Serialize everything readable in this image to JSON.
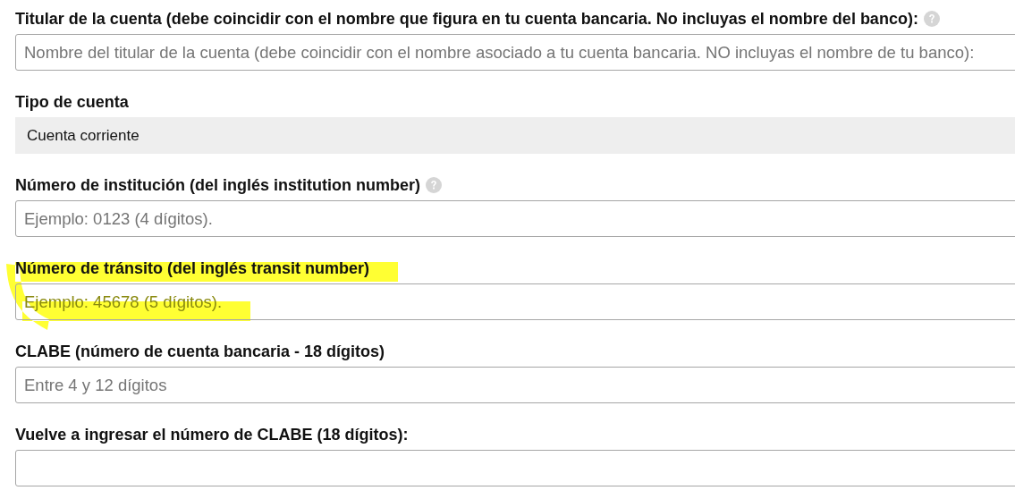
{
  "fields": [
    {
      "kind": "input",
      "label": "Titular de la cuenta (debe coincidir con el nombre que figura en tu cuenta bancaria. No incluyas el nombre del banco):",
      "help": true,
      "placeholder": "Nombre del titular de la cuenta (debe coincidir con el nombre asociado a tu cuenta bancaria. NO incluyas el nombre de tu banco):",
      "highlighted": false
    },
    {
      "kind": "static",
      "label": "Tipo de cuenta",
      "help": false,
      "value": "Cuenta corriente",
      "highlighted": false
    },
    {
      "kind": "input",
      "label": "Número de institución (del inglés institution number)",
      "help": true,
      "placeholder": "Ejemplo: 0123 (4 dígitos).",
      "highlighted": false
    },
    {
      "kind": "input",
      "label": "Número de tránsito (del inglés transit number)",
      "help": false,
      "placeholder": "Ejemplo: 45678 (5 dígitos).",
      "highlighted": true
    },
    {
      "kind": "input",
      "label": "CLABE (número de cuenta bancaria - 18 dígitos)",
      "help": false,
      "placeholder": "Entre 4 y 12 dígitos",
      "highlighted": false
    },
    {
      "kind": "input",
      "label": "Vuelve a ingresar el número de CLABE (18 dígitos):",
      "help": false,
      "highlighted": false
    }
  ]
}
